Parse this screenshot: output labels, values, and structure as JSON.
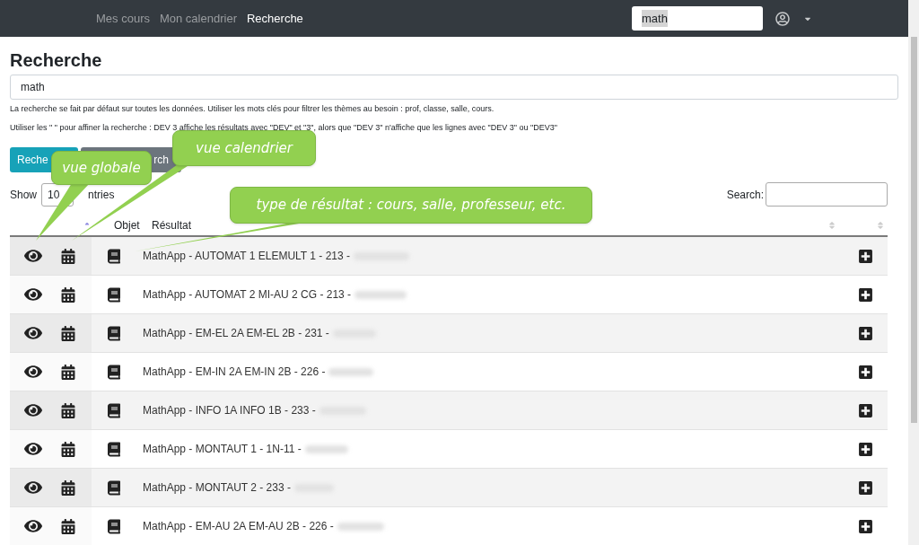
{
  "nav": {
    "links": [
      {
        "label": "Mes cours",
        "selected": false
      },
      {
        "label": "Mon calendrier",
        "selected": false
      },
      {
        "label": "Recherche",
        "selected": true
      }
    ],
    "search": {
      "value": "math"
    }
  },
  "page": {
    "title": "Recherche",
    "query": {
      "value": "math"
    },
    "help": [
      "La recherche se fait par défaut sur toutes les données. Utiliser les mots clés pour filtrer les thèmes au besoin : prof, classe, salle, cours.",
      "Utiliser les \" \" pour affiner la recherche : DEV 3 affiche les résultats avec \"DEV\" et \"3\", alors que \"DEV 3\" n'affiche que les lignes avec \"DEV 3\" ou \"DEV3\""
    ],
    "buttons": [
      {
        "label": "Reche",
        "kind": "primary"
      },
      {
        "label": "rch",
        "kind": "secondary"
      }
    ]
  },
  "table": {
    "length": {
      "label": "Show",
      "value": "10",
      "suffix": "ntries"
    },
    "search_label": "Search:",
    "columns": [
      "Objet",
      "Résultat"
    ],
    "rows": [
      {
        "result": "MathApp - AUTOMAT 1 ELEMULT 1 - 213 -"
      },
      {
        "result": "MathApp - AUTOMAT 2 MI-AU 2 CG - 213 -"
      },
      {
        "result": "MathApp - EM-EL 2A EM-EL 2B - 231 -"
      },
      {
        "result": "MathApp - EM-IN 2A EM-IN 2B - 226 -"
      },
      {
        "result": "MathApp - INFO 1A INFO 1B - 233 -"
      },
      {
        "result": "MathApp - MONTAUT 1 - 1N-11 -"
      },
      {
        "result": "MathApp - MONTAUT 2 - 233 -"
      },
      {
        "result": "MathApp - EM-AU 2A EM-AU 2B - 226 -"
      }
    ]
  },
  "callouts": [
    {
      "text": "vue globale"
    },
    {
      "text": "vue calendrier"
    },
    {
      "text": "type de résultat : cours, salle, professeur, etc."
    }
  ]
}
